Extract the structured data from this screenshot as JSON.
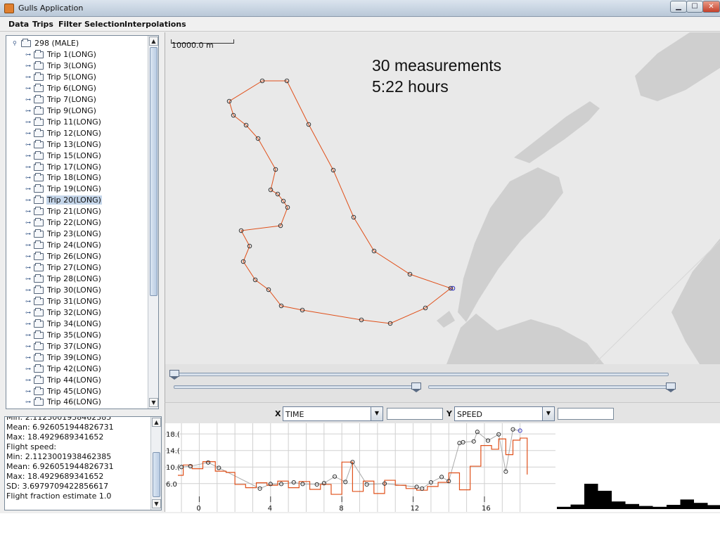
{
  "window": {
    "title": "Gulls Application",
    "minimize": "▁",
    "maximize": "☐",
    "close": "✕"
  },
  "menu": [
    "Data",
    "Trips",
    "Filter",
    "Selection",
    "Interpolations"
  ],
  "tree": {
    "root": "298 (MALE)",
    "items": [
      "Trip 1(LONG)",
      "Trip 3(LONG)",
      "Trip 5(LONG)",
      "Trip 6(LONG)",
      "Trip 7(LONG)",
      "Trip 9(LONG)",
      "Trip 11(LONG)",
      "Trip 12(LONG)",
      "Trip 13(LONG)",
      "Trip 15(LONG)",
      "Trip 17(LONG)",
      "Trip 18(LONG)",
      "Trip 19(LONG)",
      "Trip 20(LONG)",
      "Trip 21(LONG)",
      "Trip 22(LONG)",
      "Trip 23(LONG)",
      "Trip 24(LONG)",
      "Trip 26(LONG)",
      "Trip 27(LONG)",
      "Trip 28(LONG)",
      "Trip 30(LONG)",
      "Trip 31(LONG)",
      "Trip 32(LONG)",
      "Trip 34(LONG)",
      "Trip 35(LONG)",
      "Trip 37(LONG)",
      "Trip 39(LONG)",
      "Trip 42(LONG)",
      "Trip 44(LONG)",
      "Trip 45(LONG)",
      "Trip 46(LONG)"
    ],
    "selected_index": 13
  },
  "stats": {
    "lines": [
      "Min: 2.1123001938462385",
      "Mean: 6.926051944826731",
      "Max: 18.4929689341652",
      "Flight speed:",
      "Min: 2.1123001938462385",
      "Mean: 6.926051944826731",
      "Max: 18.4929689341652",
      "SD: 3.6979709422856617",
      "Flight fraction estimate 1.0"
    ]
  },
  "map": {
    "scale_label": "10000.0 m",
    "annotation_line1": "30 measurements",
    "annotation_line2": "5:22 hours",
    "track_color": "#e0501a"
  },
  "axes": {
    "x_label": "X",
    "x_value": "TIME",
    "y_label": "Y",
    "y_value": "SPEED"
  },
  "chart_data": {
    "type": "line",
    "xlabel": "TIME",
    "ylabel": "SPEED",
    "x_ticks": [
      "0",
      "4",
      "8",
      "12",
      "16"
    ],
    "y_ticks": [
      "18.(",
      "14.(",
      "10.(",
      "6.0"
    ],
    "xlim": [
      -1.2,
      19
    ],
    "ylim": [
      2.9,
      19.9
    ],
    "series": [
      {
        "type": "measurements",
        "color": "#aaaaaa",
        "x": [
          -1,
          -0.5,
          0.5,
          1.1,
          3.4,
          4.0,
          4.6,
          5.3,
          5.8,
          6.6,
          7.0,
          7.6,
          8.2,
          8.6,
          9.4,
          10.4,
          12.2,
          12.5,
          13.0,
          13.6,
          14.0,
          14.6,
          14.8,
          15.4,
          15.6,
          16.2,
          16.8,
          17.2,
          17.6,
          18.0
        ],
        "y": [
          10.0,
          10.2,
          11.1,
          9.8,
          4.8,
          5.9,
          5.9,
          6.3,
          5.9,
          5.8,
          6.1,
          7.7,
          6.4,
          11.2,
          5.8,
          6.0,
          5.2,
          4.8,
          6.3,
          7.6,
          6.6,
          15.8,
          16.0,
          16.2,
          18.5,
          16.4,
          17.9,
          8.9,
          19.1,
          18.8
        ]
      },
      {
        "type": "interpolated",
        "color": "#e0501a",
        "x": [
          -1.2,
          -0.9,
          -0.4,
          0.2,
          0.9,
          1.5,
          2.0,
          2.6,
          3.2,
          3.8,
          4.4,
          5.0,
          5.6,
          6.2,
          6.8,
          7.4,
          8.0,
          8.6,
          9.2,
          9.8,
          10.4,
          11.0,
          11.6,
          12.2,
          12.8,
          13.4,
          14.0,
          14.6,
          15.2,
          15.8,
          16.4,
          16.8,
          17.2,
          17.6,
          18.0,
          18.4
        ],
        "y": [
          8.0,
          10.5,
          9.6,
          11.3,
          9.0,
          8.7,
          5.8,
          5.0,
          6.2,
          5.6,
          6.6,
          5.0,
          6.5,
          4.6,
          5.8,
          3.4,
          11.2,
          4.1,
          6.6,
          3.6,
          6.8,
          5.6,
          4.8,
          4.4,
          5.3,
          6.3,
          8.6,
          4.5,
          10.2,
          15.2,
          14.3,
          16.8,
          13.0,
          16.5,
          17.0,
          8.2
        ]
      }
    ]
  },
  "histogram": {
    "values": [
      0.08,
      0.16,
      0.9,
      0.65,
      0.27,
      0.18,
      0.11,
      0.08,
      0.15,
      0.34,
      0.22,
      0.14
    ],
    "color": "#000000"
  }
}
